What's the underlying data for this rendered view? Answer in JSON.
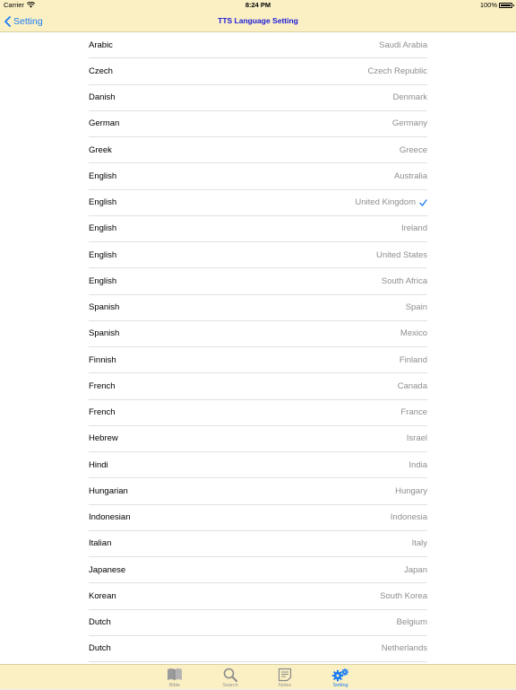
{
  "status_bar": {
    "carrier": "Carrier",
    "time": "8:24 PM",
    "battery": "100%"
  },
  "nav": {
    "back_label": "Setting",
    "title": "TTS Language Setting"
  },
  "languages": [
    {
      "language": "Arabic",
      "country": "Saudi Arabia",
      "selected": false
    },
    {
      "language": "Czech",
      "country": "Czech Republic",
      "selected": false
    },
    {
      "language": "Danish",
      "country": "Denmark",
      "selected": false
    },
    {
      "language": "German",
      "country": "Germany",
      "selected": false
    },
    {
      "language": "Greek",
      "country": "Greece",
      "selected": false
    },
    {
      "language": "English",
      "country": "Australia",
      "selected": false
    },
    {
      "language": "English",
      "country": "United Kingdom",
      "selected": true
    },
    {
      "language": "English",
      "country": "Ireland",
      "selected": false
    },
    {
      "language": "English",
      "country": "United States",
      "selected": false
    },
    {
      "language": "English",
      "country": "South Africa",
      "selected": false
    },
    {
      "language": "Spanish",
      "country": "Spain",
      "selected": false
    },
    {
      "language": "Spanish",
      "country": "Mexico",
      "selected": false
    },
    {
      "language": "Finnish",
      "country": "Finland",
      "selected": false
    },
    {
      "language": "French",
      "country": "Canada",
      "selected": false
    },
    {
      "language": "French",
      "country": "France",
      "selected": false
    },
    {
      "language": "Hebrew",
      "country": "Israel",
      "selected": false
    },
    {
      "language": "Hindi",
      "country": "India",
      "selected": false
    },
    {
      "language": "Hungarian",
      "country": "Hungary",
      "selected": false
    },
    {
      "language": "Indonesian",
      "country": "Indonesia",
      "selected": false
    },
    {
      "language": "Italian",
      "country": "Italy",
      "selected": false
    },
    {
      "language": "Japanese",
      "country": "Japan",
      "selected": false
    },
    {
      "language": "Korean",
      "country": "South Korea",
      "selected": false
    },
    {
      "language": "Dutch",
      "country": "Belgium",
      "selected": false
    },
    {
      "language": "Dutch",
      "country": "Netherlands",
      "selected": false
    }
  ],
  "tabs": [
    {
      "label": "Bible",
      "icon": "bible-book-icon",
      "active": false
    },
    {
      "label": "Search",
      "icon": "magnifier-icon",
      "active": false
    },
    {
      "label": "Notes",
      "icon": "notes-icon",
      "active": false
    },
    {
      "label": "Setting",
      "icon": "gears-icon",
      "active": true
    }
  ],
  "colors": {
    "accent": "#1a7cf5",
    "bar_background": "#fbf0c4",
    "title": "#1a1ad6",
    "secondary_text": "#8e8e93"
  }
}
